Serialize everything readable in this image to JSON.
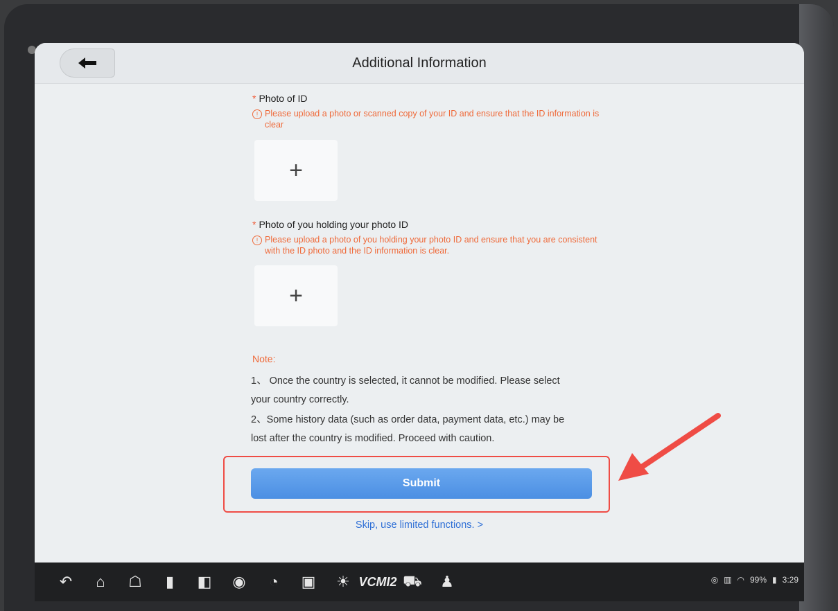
{
  "header": {
    "title": "Additional Information"
  },
  "photo_id": {
    "label": "Photo of ID",
    "hint": "Please upload a photo or scanned copy of your ID and ensure that the ID information is clear"
  },
  "photo_holding": {
    "label": "Photo of you holding your photo ID",
    "hint": "Please upload a photo of you holding your photo ID and ensure that you are consistent with the ID photo and the ID information is clear."
  },
  "note": {
    "title": "Note:",
    "line1a": "1、 Once the country is selected, it cannot be modified. Please select",
    "line1b": "your country correctly.",
    "line2a": "2、Some history data (such as order data, payment data, etc.) may be",
    "line2b": "lost after the country is modified. Proceed with caution."
  },
  "actions": {
    "submit_label": "Submit",
    "skip_label": "Skip, use limited functions.  >"
  },
  "upload_glyph": "+",
  "status_bar": {
    "vcmi_label": "VCMI2",
    "battery": "99%",
    "time": "3:29"
  },
  "colors": {
    "accent": "#4b8fe3",
    "warning": "#ef6a3a",
    "highlight": "#ef4c45"
  }
}
